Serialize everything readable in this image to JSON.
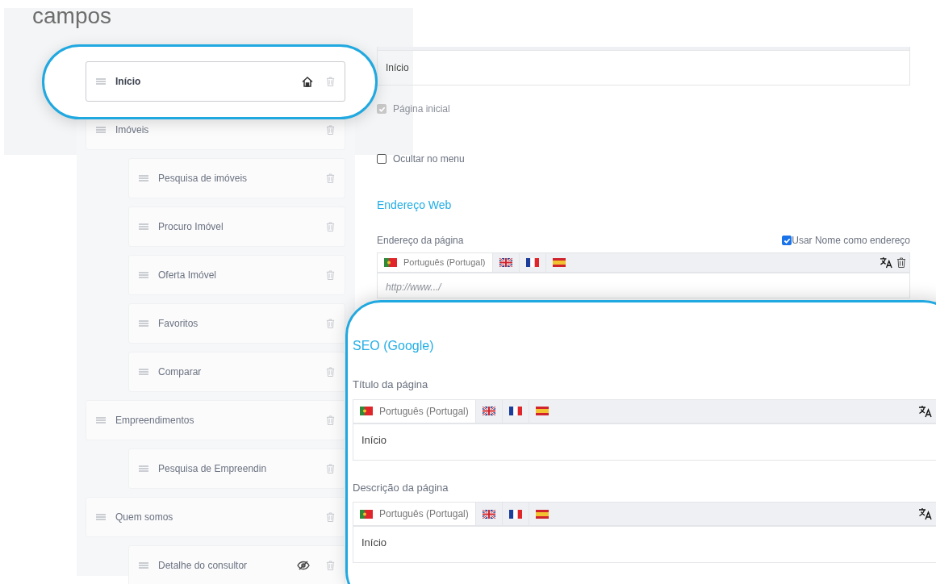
{
  "heading": "campos",
  "tree": {
    "items": [
      {
        "label": "Início",
        "selected": true,
        "home": true,
        "hidden": false
      },
      {
        "label": "Imóveis",
        "selected": false,
        "home": false,
        "hidden": false,
        "children": [
          {
            "label": "Pesquisa de imóveis",
            "selected": false,
            "home": false,
            "hidden": false
          },
          {
            "label": "Procuro Imóvel",
            "selected": false,
            "home": false,
            "hidden": false
          },
          {
            "label": "Oferta Imóvel",
            "selected": false,
            "home": false,
            "hidden": false
          },
          {
            "label": "Favoritos",
            "selected": false,
            "home": false,
            "hidden": false
          },
          {
            "label": "Comparar",
            "selected": false,
            "home": false,
            "hidden": false
          }
        ]
      },
      {
        "label": "Empreendimentos",
        "selected": false,
        "home": false,
        "hidden": false,
        "children": [
          {
            "label": "Pesquisa de Empreendin",
            "selected": false,
            "home": false,
            "hidden": false
          }
        ]
      },
      {
        "label": "Quem somos",
        "selected": false,
        "home": false,
        "hidden": false,
        "children": [
          {
            "label": "Detalhe do consultor",
            "selected": false,
            "home": false,
            "hidden": true
          }
        ]
      }
    ]
  },
  "form": {
    "name_value": "Início",
    "options": [
      {
        "label": "Página inicial",
        "checked": true,
        "disabled": true
      },
      {
        "label": "Ocultar no menu",
        "checked": false,
        "disabled": false
      }
    ],
    "web_section": "Endereço Web",
    "address": {
      "label": "Endereço da página",
      "use_name": {
        "label": "Usar Nome como endereço",
        "checked": true
      },
      "languages": [
        {
          "kind": "pt",
          "label": "Português (Portugal)",
          "selected": true
        },
        {
          "kind": "gb",
          "selected": false
        },
        {
          "kind": "fr",
          "selected": false
        },
        {
          "kind": "es",
          "selected": false
        }
      ],
      "placeholder": "http://www.../"
    }
  },
  "seo": {
    "title": "SEO (Google)",
    "fields": [
      {
        "label": "Título da página",
        "value": "Início",
        "languages": [
          {
            "kind": "pt",
            "label": "Português (Portugal)",
            "selected": true
          },
          {
            "kind": "gb",
            "selected": false
          },
          {
            "kind": "fr",
            "selected": false
          },
          {
            "kind": "es",
            "selected": false
          }
        ]
      },
      {
        "label": "Descrição da página",
        "value": "Início",
        "languages": [
          {
            "kind": "pt",
            "label": "Português (Portugal)",
            "selected": true
          },
          {
            "kind": "gb",
            "selected": false
          },
          {
            "kind": "fr",
            "selected": false
          },
          {
            "kind": "es",
            "selected": false
          }
        ]
      }
    ]
  }
}
